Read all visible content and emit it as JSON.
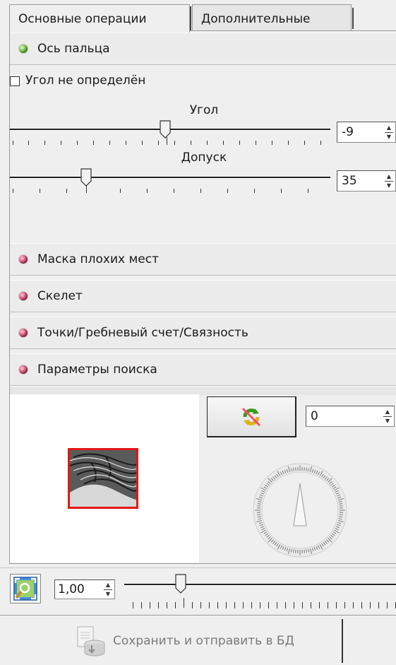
{
  "tabs": [
    {
      "label": "Основные операции",
      "active": true
    },
    {
      "label": "Дополнительные",
      "active": false
    }
  ],
  "sections": {
    "finger_axis": {
      "label": "Ось пальца",
      "status": "green",
      "expanded": true
    },
    "bad_mask": {
      "label": "Маска плохих мест",
      "status": "red"
    },
    "skeleton": {
      "label": "Скелет",
      "status": "red"
    },
    "points": {
      "label": "Точки/Гребневый счет/Связность",
      "status": "red"
    },
    "search": {
      "label": "Параметры поиска",
      "status": "red"
    }
  },
  "finger_axis": {
    "undefined_checkbox_label": "Угол не определён",
    "undefined_checked": false,
    "angle": {
      "label": "Угол",
      "value": "-9"
    },
    "tolerance": {
      "label": "Допуск",
      "value": "35"
    }
  },
  "rotation": {
    "value": "0"
  },
  "zoom": {
    "value": "1,00"
  },
  "save_button": {
    "label": "Сохранить и отправить в БД",
    "enabled": false
  },
  "colors": {
    "status_green": "#6fc33a",
    "status_red": "#e0416f",
    "thumbnail_border": "#e01818"
  }
}
